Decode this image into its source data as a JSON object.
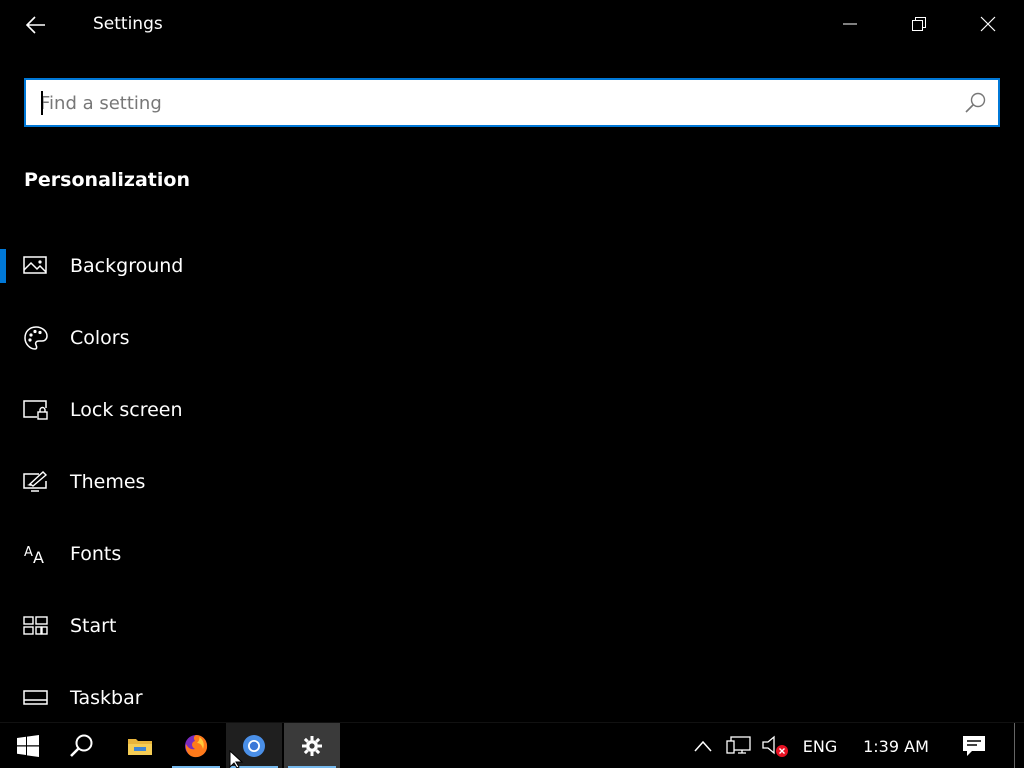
{
  "window": {
    "title": "Settings"
  },
  "search": {
    "placeholder": "Find a setting"
  },
  "section": {
    "title": "Personalization"
  },
  "nav": {
    "items": [
      {
        "label": "Background",
        "icon": "image-icon",
        "selected": true
      },
      {
        "label": "Colors",
        "icon": "palette-icon",
        "selected": false
      },
      {
        "label": "Lock screen",
        "icon": "lock-screen-icon",
        "selected": false
      },
      {
        "label": "Themes",
        "icon": "themes-icon",
        "selected": false
      },
      {
        "label": "Fonts",
        "icon": "fonts-icon",
        "selected": false
      },
      {
        "label": "Start",
        "icon": "start-layout-icon",
        "selected": false
      },
      {
        "label": "Taskbar",
        "icon": "taskbar-icon",
        "selected": false
      }
    ]
  },
  "taskbar": {
    "apps": [
      "start",
      "search",
      "file-explorer",
      "firefox",
      "chrome",
      "settings"
    ],
    "tray": {
      "language": "ENG",
      "time": "1:39 AM"
    }
  },
  "colors": {
    "accent": "#0078d7",
    "background": "#000000",
    "taskbar_active": "#3a3a3a"
  }
}
